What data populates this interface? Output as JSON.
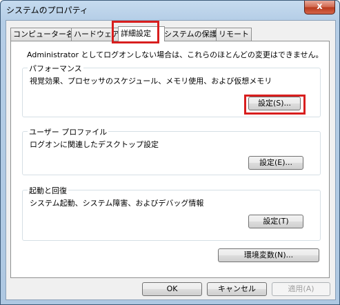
{
  "window": {
    "title": "システムのプロパティ",
    "close_glyph": "x"
  },
  "tabs": [
    {
      "label": "コンピューター名"
    },
    {
      "label": "ハードウェア"
    },
    {
      "label": "詳細設定"
    },
    {
      "label": "システムの保護"
    },
    {
      "label": "リモート"
    }
  ],
  "admin_note": "Administrator としてログオンしない場合は、これらのほとんどの変更はできません。",
  "performance": {
    "label": "パフォーマンス",
    "description": "視覚効果、プロセッサのスケジュール、メモリ使用、および仮想メモリ",
    "button": "設定(S)..."
  },
  "user_profile": {
    "label": "ユーザー プロファイル",
    "description": "ログオンに関連したデスクトップ設定",
    "button": "設定(E)..."
  },
  "startup_recovery": {
    "label": "起動と回復",
    "description": "システム起動、システム障害、およびデバッグ情報",
    "button": "設定(T)"
  },
  "env_button": "環境変数(N)...",
  "footer": {
    "ok": "OK",
    "cancel": "キャンセル",
    "apply": "適用(A)"
  },
  "colors": {
    "highlight": "#d81e1e",
    "title_gradient": "#b4cde6",
    "panel": "#ffffff"
  }
}
